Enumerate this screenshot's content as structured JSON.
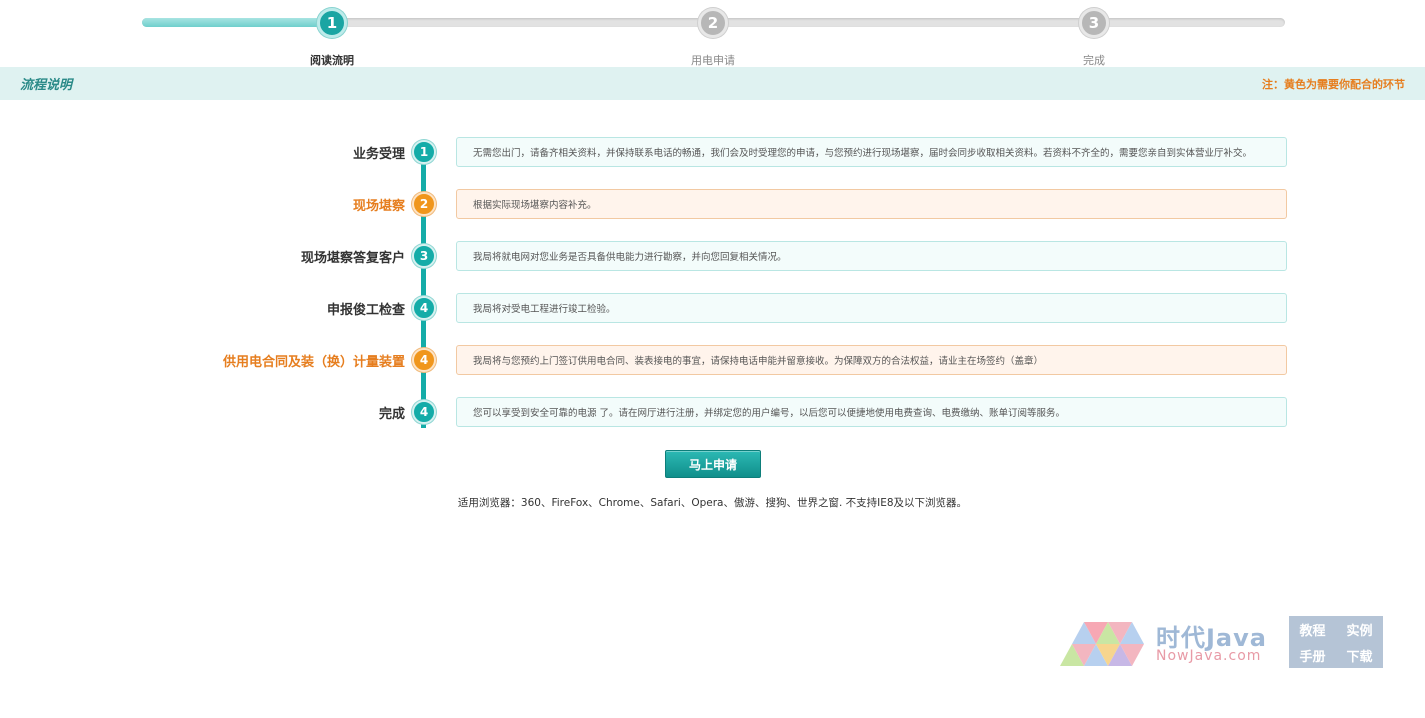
{
  "stepper": {
    "steps": [
      {
        "number": "1",
        "label": "阅读流明"
      },
      {
        "number": "2",
        "label": "用电申请"
      },
      {
        "number": "3",
        "label": "完成"
      }
    ]
  },
  "section": {
    "title": "流程说明",
    "note": "注：黄色为需要你配合的环节"
  },
  "timeline": {
    "items": [
      {
        "name": "业务受理",
        "number": "1",
        "highlight": false,
        "desc": "无需您出门，请备齐相关资料，并保持联系电话的畅通，我们会及时受理您的申请，与您预约进行现场堪察，届时会同步收取相关资料。若资料不齐全的，需要您亲自到实体营业厅补交。"
      },
      {
        "name": "现场堪察",
        "number": "2",
        "highlight": true,
        "desc": "根据实际现场堪察内容补充。"
      },
      {
        "name": "现场堪察答复客户",
        "number": "3",
        "highlight": false,
        "desc": "我局将就电网对您业务是否具备供电能力进行勘察，并向您回复相关情况。"
      },
      {
        "name": "申报俊工检查",
        "number": "4",
        "highlight": false,
        "desc": "我局将对受电工程进行竣工检验。"
      },
      {
        "name": "供用电合同及装（换）计量装置",
        "number": "4",
        "highlight": true,
        "desc": "我局将与您预约上门签订供用电合同、装表接电的事宜，请保持电话申能并留意接收。为保障双方的合法权益，请业主在场签约（盖章）"
      },
      {
        "name": "完成",
        "number": "4",
        "highlight": false,
        "desc": "您可以享受到安全可靠的电源 了。请在网厅进行注册，并绑定您的用户编号，以后您可以便捷地使用电费查询、电费缴纳、账单订阅等服务。"
      }
    ]
  },
  "actions": {
    "apply_label": "马上申请"
  },
  "browser_note": "适用浏览器：360、FireFox、Chrome、Safari、Opera、傲游、搜狗、世界之窗. 不支持IE8及以下浏览器。",
  "watermark": {
    "brand": "时代Java",
    "domain": "NowJava.com",
    "links": [
      "教程",
      "实例",
      "手册",
      "下载"
    ]
  },
  "colors": {
    "accent": "#14aca8",
    "highlight": "#f0961c",
    "section_bg": "#dff2f1"
  }
}
